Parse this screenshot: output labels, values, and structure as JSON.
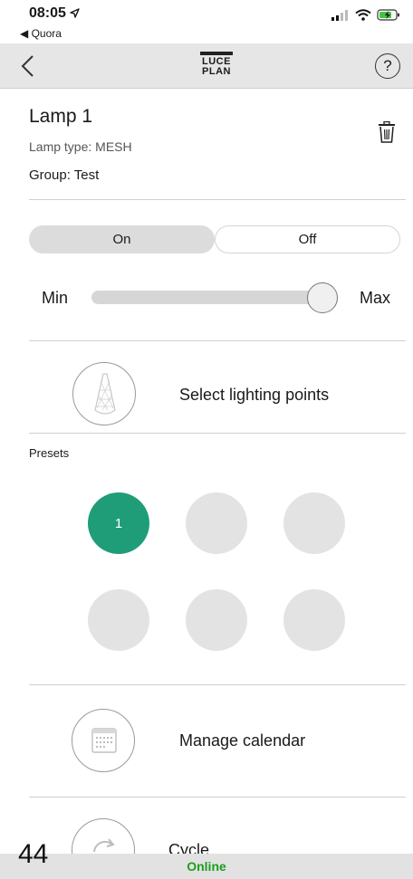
{
  "status_bar": {
    "time": "08:05",
    "back_app": "◀ Quora"
  },
  "nav": {
    "logo_line1": "LUCE",
    "logo_line2": "PLAN",
    "help_symbol": "?"
  },
  "lamp": {
    "title": "Lamp 1",
    "type": "Lamp type: MESH",
    "group": "Group: Test"
  },
  "power": {
    "on_label": "On",
    "off_label": "Off",
    "selected": "On"
  },
  "brightness": {
    "min_label": "Min",
    "max_label": "Max",
    "level": 1.0
  },
  "lighting_points": {
    "label": "Select lighting points"
  },
  "presets": {
    "heading": "Presets",
    "items": [
      {
        "label": "1",
        "active": true
      },
      {
        "label": "",
        "active": false
      },
      {
        "label": "",
        "active": false
      },
      {
        "label": "",
        "active": false
      },
      {
        "label": "",
        "active": false
      },
      {
        "label": "",
        "active": false
      }
    ]
  },
  "calendar": {
    "label": "Manage calendar"
  },
  "cycle": {
    "label": "Cycle"
  },
  "footer": {
    "page_number": "44",
    "connection_status": "Online"
  },
  "colors": {
    "accent": "#1e9d78",
    "online": "#1e9d1e",
    "nav_bg": "#e6e6e6"
  }
}
